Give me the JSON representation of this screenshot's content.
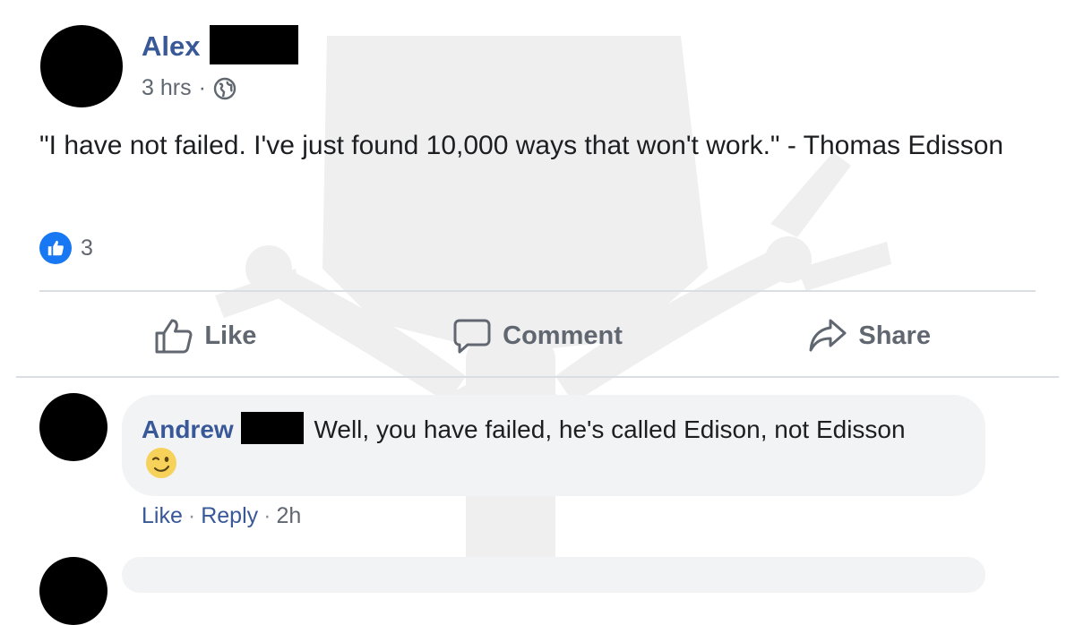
{
  "post": {
    "author_name": "Alex",
    "time": "3 hrs",
    "separator": "·",
    "privacy_icon": "globe-icon",
    "text": "\"I have not failed. I've just found 10,000 ways that won't work.\" - Thomas Edisson",
    "reaction_icon": "like-icon",
    "reaction_count": "3"
  },
  "actions": {
    "like_label": "Like",
    "comment_label": "Comment",
    "share_label": "Share"
  },
  "comment": {
    "author_name": "Andrew",
    "text": "Well, you have failed, he's called Edison, not Edisson",
    "emoji": "wink-emoji",
    "like_label": "Like",
    "separator": "·",
    "reply_label": "Reply",
    "time": "2h"
  },
  "colors": {
    "link_blue": "#385898",
    "like_blue": "#1877f2",
    "meta_gray": "#606770",
    "bubble_gray": "#f2f3f5",
    "divider": "#dadde1"
  }
}
